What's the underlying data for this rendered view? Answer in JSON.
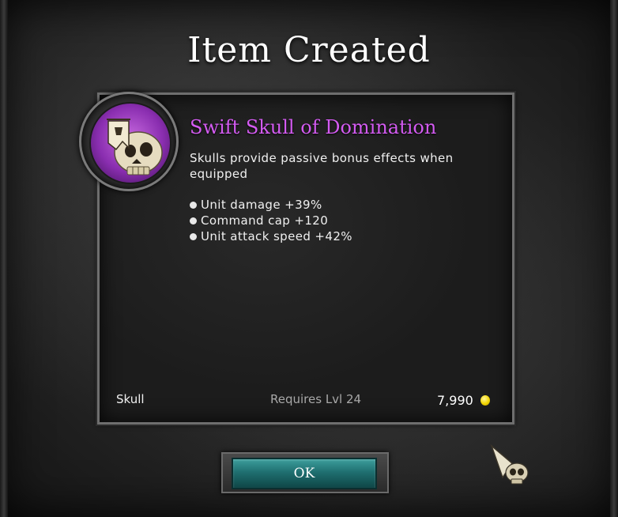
{
  "dialog": {
    "title": "Item Created",
    "ok_label": "OK"
  },
  "item": {
    "name": "Swift Skull of Domination",
    "name_color": "#d45bf2",
    "icon": "skull-with-banner-icon",
    "description": "Skulls provide passive bonus effects when equipped",
    "stats": [
      "Unit damage +39%",
      "Command cap +120",
      "Unit attack speed +42%"
    ],
    "type": "Skull",
    "requirement": "Requires Lvl 24",
    "price": "7,990",
    "currency_icon": "gold-coin-icon"
  },
  "cursor_icon": "skull-pointer-cursor-icon"
}
